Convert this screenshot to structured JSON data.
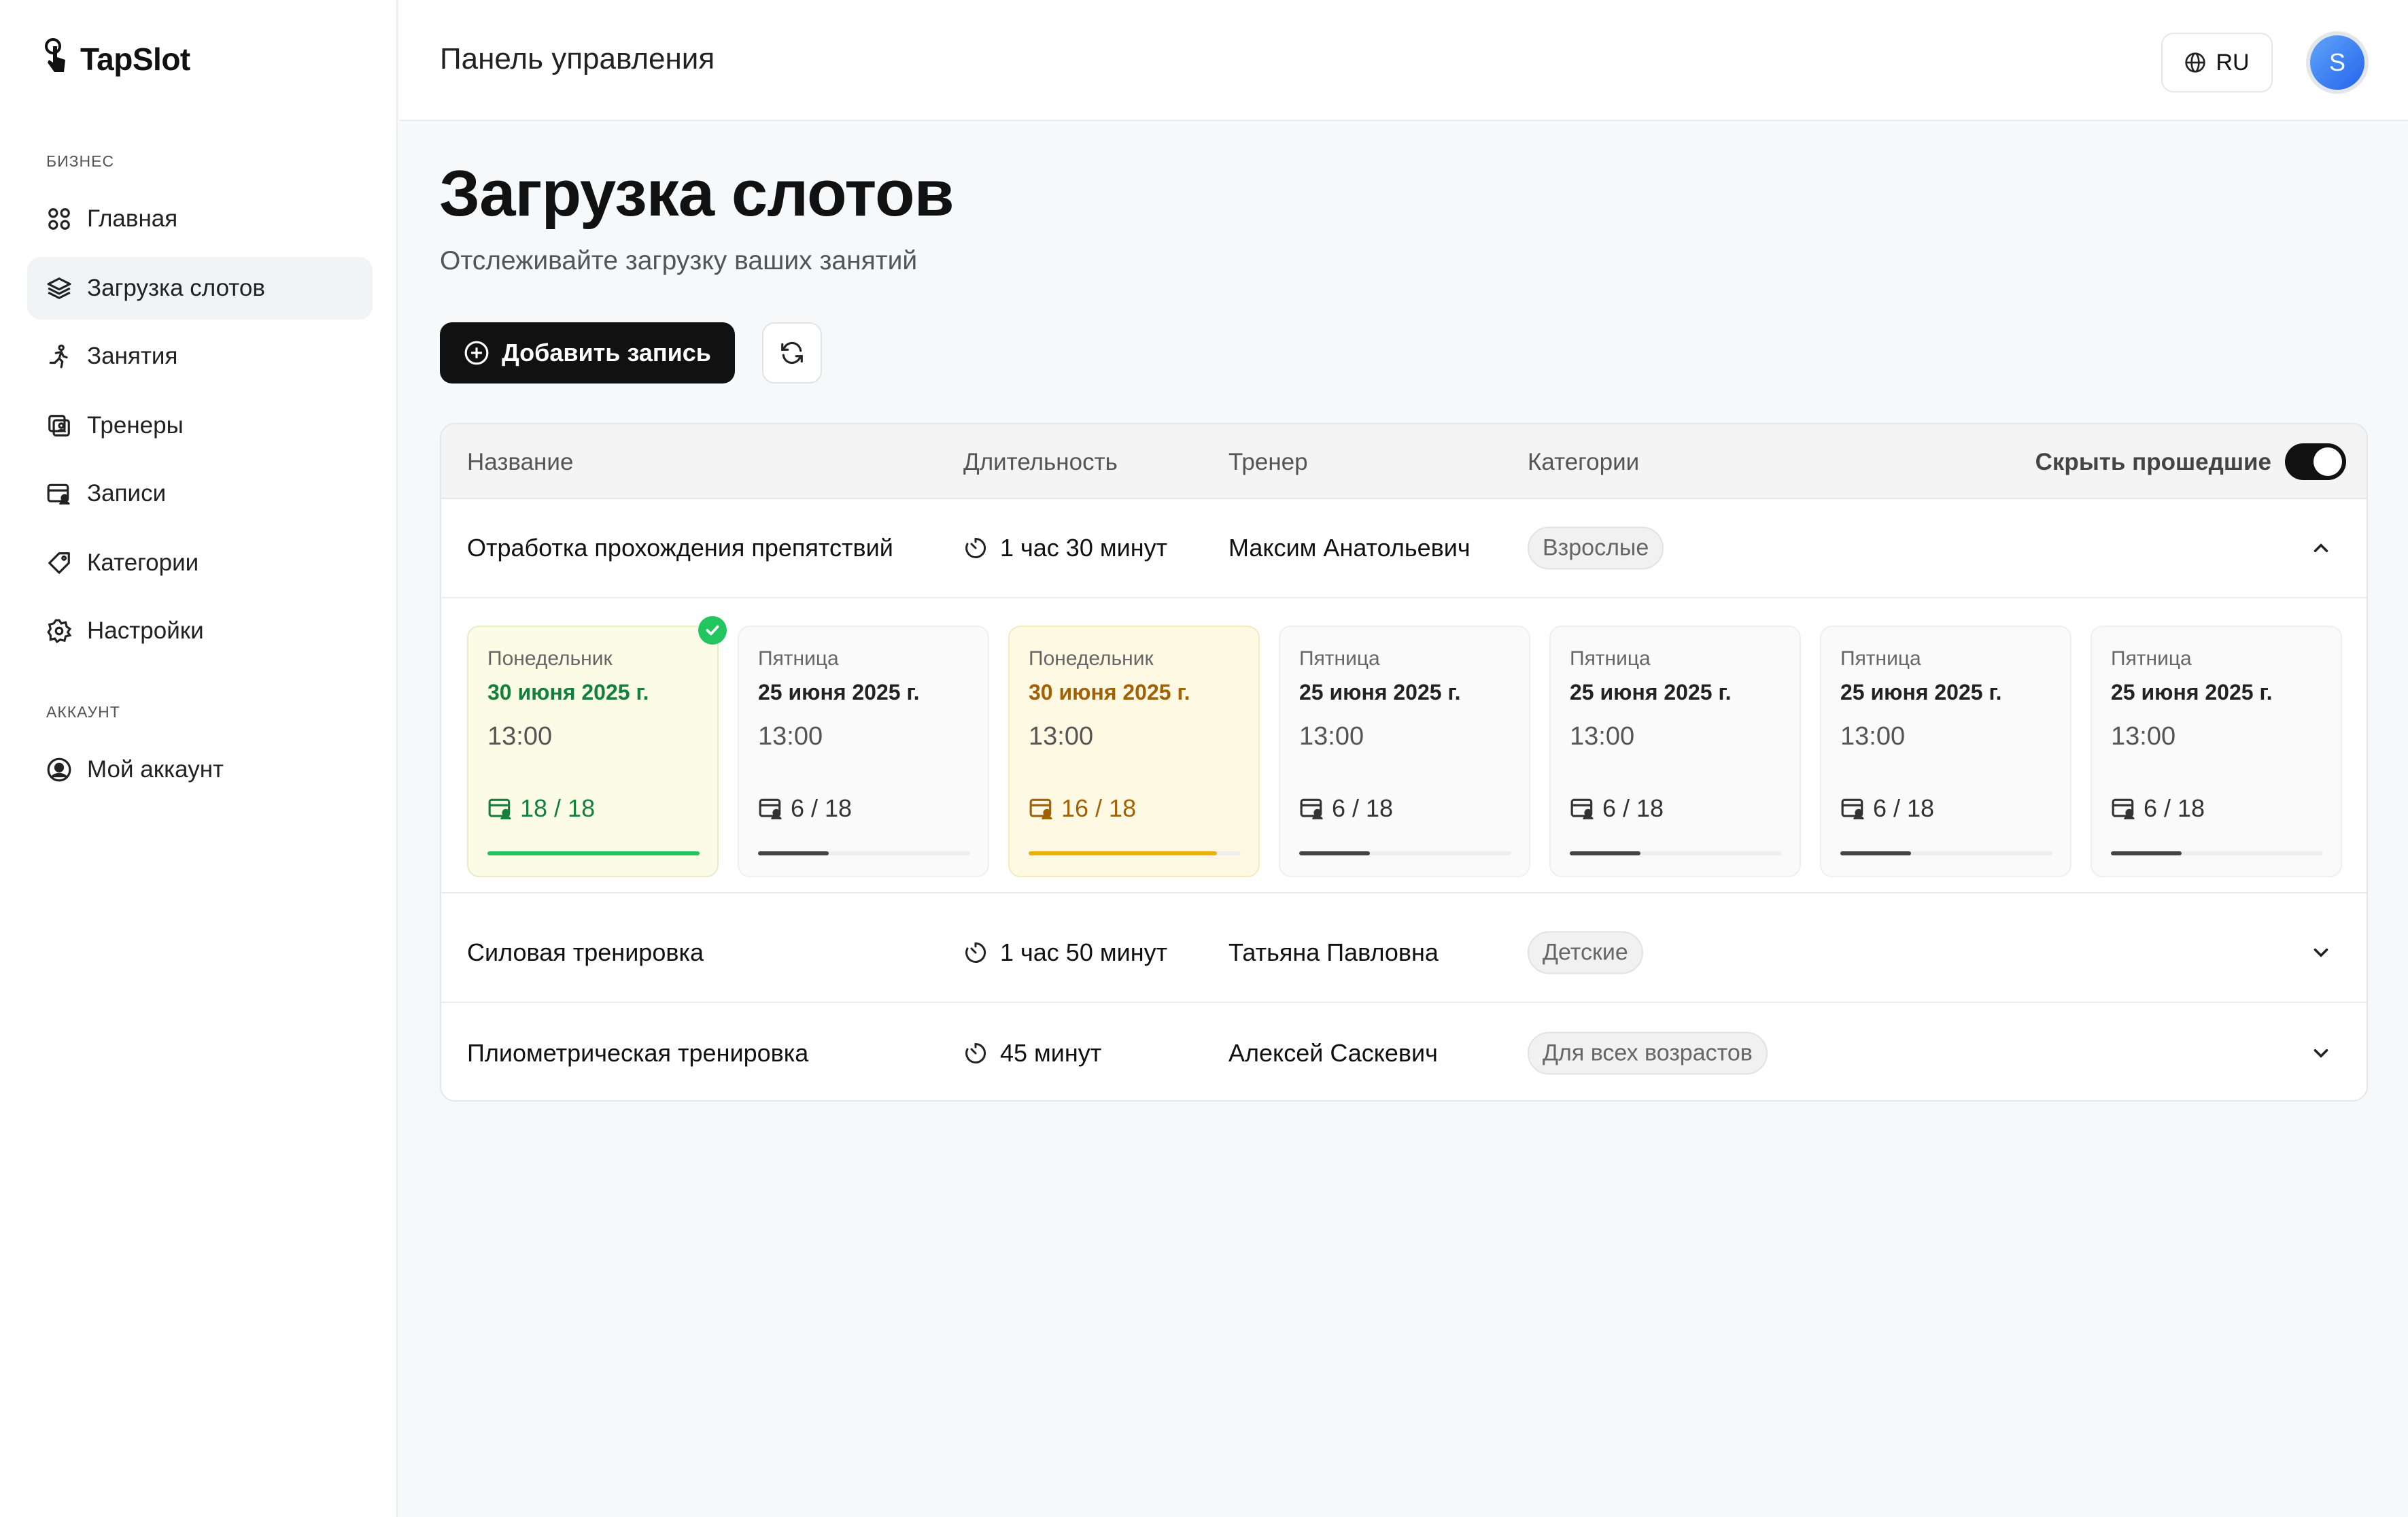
{
  "app": {
    "name": "TapSlot"
  },
  "sidebar": {
    "section_business": "БИЗНЕС",
    "section_account": "АККАУНТ",
    "items": [
      {
        "label": "Главная",
        "icon": "grid-icon"
      },
      {
        "label": "Загрузка слотов",
        "icon": "layers-icon",
        "active": true
      },
      {
        "label": "Занятия",
        "icon": "running-icon"
      },
      {
        "label": "Тренеры",
        "icon": "trainers-icon"
      },
      {
        "label": "Записи",
        "icon": "calendar-user-icon"
      },
      {
        "label": "Категории",
        "icon": "tag-icon"
      },
      {
        "label": "Настройки",
        "icon": "gear-icon"
      }
    ],
    "account_items": [
      {
        "label": "Мой аккаунт",
        "icon": "user-circle-icon"
      }
    ]
  },
  "header": {
    "title": "Панель управления",
    "lang": "RU",
    "avatar_initial": "S"
  },
  "main": {
    "title": "Загрузка слотов",
    "subtitle": "Отслеживайте загрузку ваших занятий",
    "add_button": "Добавить запись",
    "table": {
      "columns": {
        "name": "Название",
        "duration": "Длительность",
        "trainer": "Тренер",
        "categories": "Категории"
      },
      "hide_past_label": "Скрыть прошедшие",
      "hide_past": true,
      "rows": [
        {
          "name": "Отработка прохождения препятствий",
          "duration": "1 час 30 минут",
          "trainer": "Максим Анатольевич",
          "category": "Взрослые",
          "expanded": true
        },
        {
          "name": "Силовая тренировка",
          "duration": "1 час 50 минут",
          "trainer": "Татьяна Павловна",
          "category": "Детские",
          "expanded": false
        },
        {
          "name": "Плиометрическая тренировка",
          "duration": "45 минут",
          "trainer": "Алексей Саскевич",
          "category": "Для всех возрастов",
          "expanded": false
        }
      ],
      "slots": [
        {
          "day": "Понедельник",
          "date": "30 июня 2025 г.",
          "time": "13:00",
          "count": "18 / 18",
          "fill": 1.0,
          "status": "full"
        },
        {
          "day": "Пятница",
          "date": "25 июня 2025 г.",
          "time": "13:00",
          "count": "6 / 18",
          "fill": 0.333,
          "status": "normal"
        },
        {
          "day": "Понедельник",
          "date": "30 июня 2025 г.",
          "time": "13:00",
          "count": "16 / 18",
          "fill": 0.889,
          "status": "warning"
        },
        {
          "day": "Пятница",
          "date": "25 июня 2025 г.",
          "time": "13:00",
          "count": "6 / 18",
          "fill": 0.333,
          "status": "normal"
        },
        {
          "day": "Пятница",
          "date": "25 июня 2025 г.",
          "time": "13:00",
          "count": "6 / 18",
          "fill": 0.333,
          "status": "normal"
        },
        {
          "day": "Пятница",
          "date": "25 июня 2025 г.",
          "time": "13:00",
          "count": "6 / 18",
          "fill": 0.333,
          "status": "normal"
        },
        {
          "day": "Пятница",
          "date": "25 июня 2025 г.",
          "time": "13:00",
          "count": "6 / 18",
          "fill": 0.333,
          "status": "normal"
        }
      ]
    }
  },
  "colors": {
    "full": "#22c55e",
    "warning": "#eab308",
    "normal": "#444444",
    "primary": "#111111"
  }
}
